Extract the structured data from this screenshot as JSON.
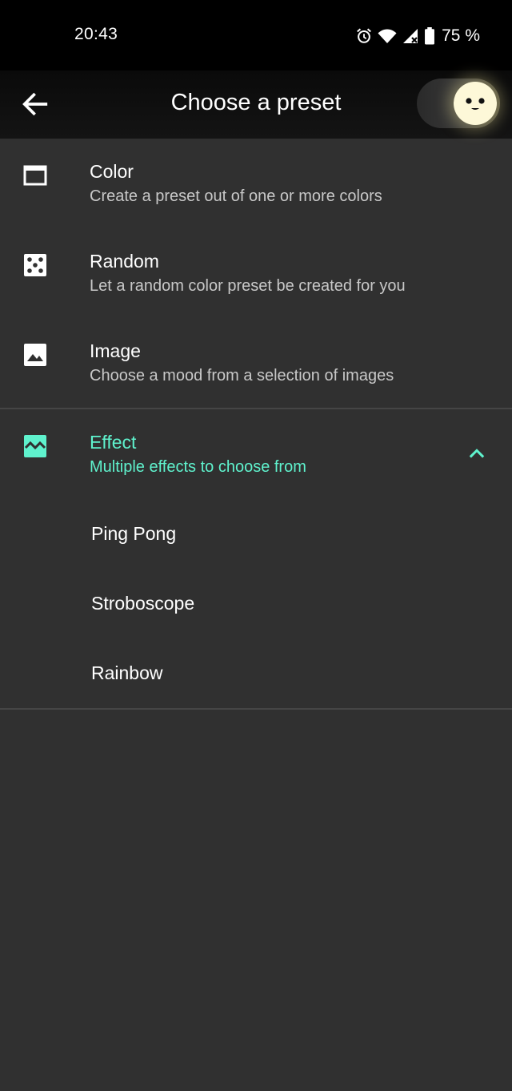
{
  "status_bar": {
    "time": "20:43",
    "battery": "75 %",
    "icons": [
      "alarm-icon",
      "wifi-icon",
      "signal-icon",
      "battery-icon"
    ]
  },
  "toolbar": {
    "title": "Choose a preset",
    "back_icon": "arrow-left-icon",
    "toggle_state": "on"
  },
  "list": {
    "items": [
      {
        "title": "Color",
        "subtitle": "Create a preset out of one or more colors",
        "icon": "window-icon"
      },
      {
        "title": "Random",
        "subtitle": "Let a random color preset be created for you",
        "icon": "dice-icon"
      },
      {
        "title": "Image",
        "subtitle": "Choose a mood from a selection of images",
        "icon": "image-icon"
      }
    ],
    "effect": {
      "title": "Effect",
      "subtitle": "Multiple effects to choose from",
      "icon": "effect-wave-icon",
      "expanded": true,
      "options": [
        "Ping Pong",
        "Stroboscope",
        "Rainbow"
      ]
    }
  },
  "colors": {
    "accent": "#5ff2cd",
    "background": "#303030",
    "toolbar": "#000000",
    "divider": "#454545"
  }
}
